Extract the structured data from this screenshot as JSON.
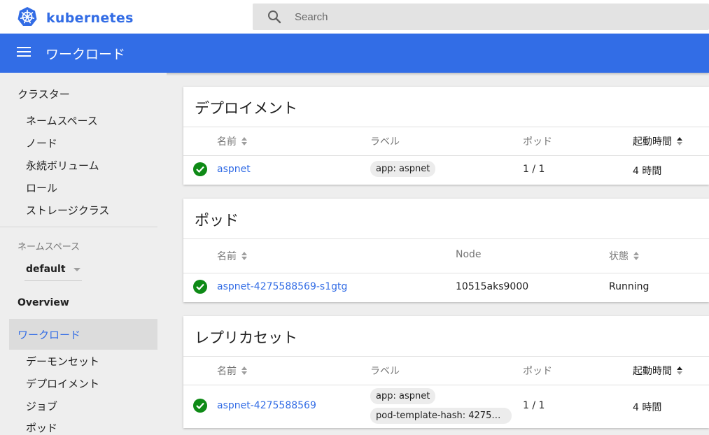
{
  "brand": {
    "name": "kubernetes"
  },
  "search": {
    "placeholder": "Search"
  },
  "appbar": {
    "title": "ワークロード"
  },
  "sidebar": {
    "cluster": {
      "label": "クラスター",
      "items": [
        "ネームスペース",
        "ノード",
        "永続ボリューム",
        "ロール",
        "ストレージクラス"
      ]
    },
    "namespace_label": "ネームスペース",
    "namespace_value": "default",
    "overview": "Overview",
    "workloads": {
      "label": "ワークロード",
      "items": [
        "デーモンセット",
        "デプロイメント",
        "ジョブ",
        "ポッド"
      ]
    }
  },
  "deployments": {
    "title": "デプロイメント",
    "headers": {
      "name": "名前",
      "labels": "ラベル",
      "pods": "ポッド",
      "age": "起動時間"
    },
    "rows": [
      {
        "name": "aspnet",
        "label": "app: aspnet",
        "pods": "1 / 1",
        "age": "4 時間"
      }
    ]
  },
  "pods": {
    "title": "ポッド",
    "headers": {
      "name": "名前",
      "node": "Node",
      "status": "状態"
    },
    "rows": [
      {
        "name": "aspnet-4275588569-s1gtg",
        "node": "10515aks9000",
        "status": "Running"
      }
    ]
  },
  "replicasets": {
    "title": "レプリカセット",
    "headers": {
      "name": "名前",
      "labels": "ラベル",
      "pods": "ポッド",
      "age": "起動時間"
    },
    "rows": [
      {
        "name": "aspnet-4275588569",
        "labels": [
          "app: aspnet",
          "pod-template-hash: 427558…"
        ],
        "pods": "1 / 1",
        "age": "4 時間"
      }
    ]
  },
  "colors": {
    "brand": "#326ce5",
    "appbar": "#326de6",
    "ok": "#0e8a16"
  }
}
